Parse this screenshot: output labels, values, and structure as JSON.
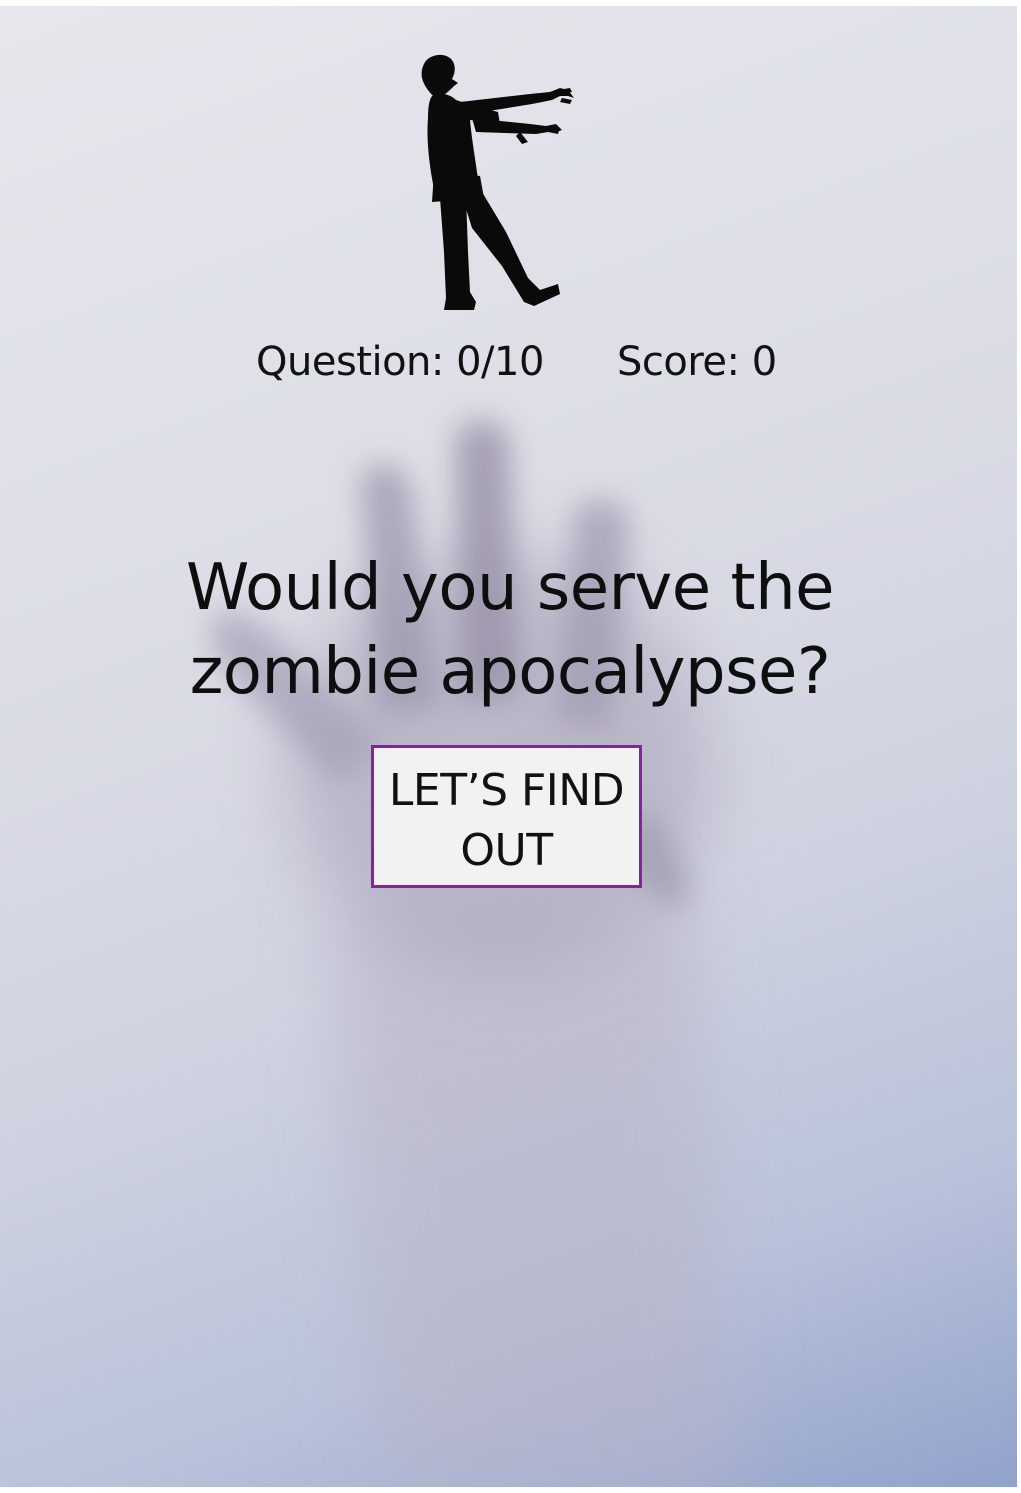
{
  "stats": {
    "question": "Question: 0/10",
    "score": "Score: 0"
  },
  "headline": {
    "line1": "Would you serve the",
    "line2": "zombie apocalypse?"
  },
  "cta": {
    "line1": "LET’S FIND",
    "line2": "OUT"
  },
  "colors": {
    "accent_border": "#8a1fa6",
    "text": "#111111",
    "button_bg": "#f2f2f3"
  },
  "icons": {
    "logo": "zombie-silhouette-icon",
    "background": "hand-behind-glass"
  }
}
